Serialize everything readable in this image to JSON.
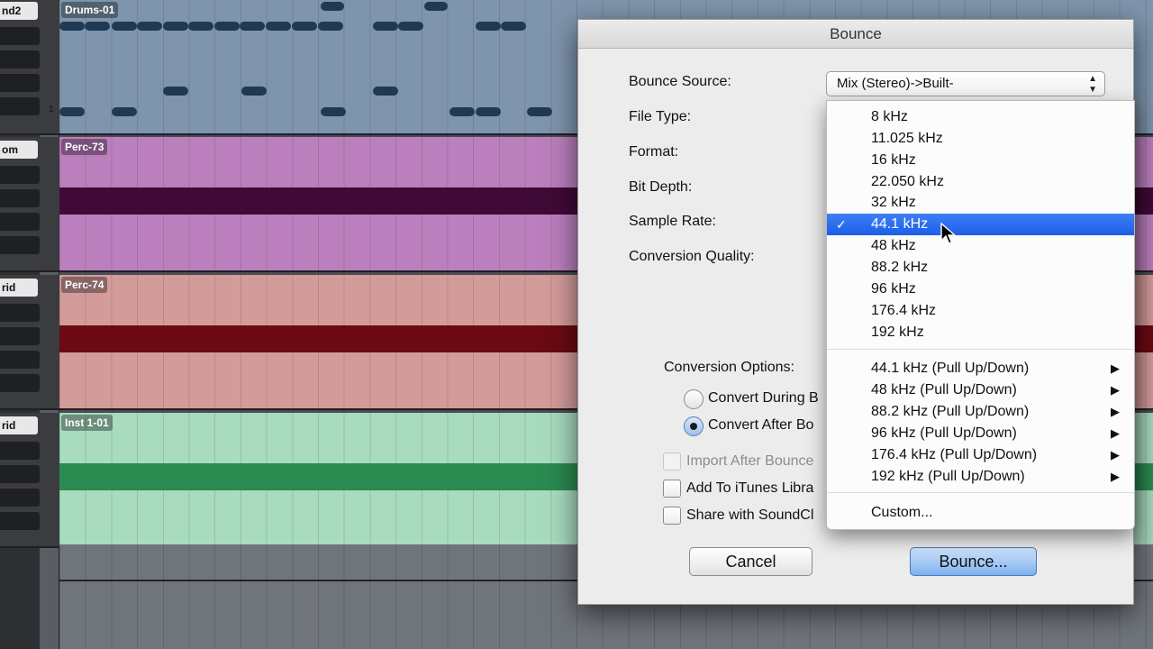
{
  "tracks": [
    {
      "header": "nd2",
      "region": "Drums-01",
      "color": "#7f95ad",
      "bar_color": ""
    },
    {
      "header": "om",
      "region": "Perc-73",
      "color": "#bb7fbe",
      "bar_color": "#3f0a36"
    },
    {
      "header": "rid",
      "region": "Perc-74",
      "color": "#d39c9b",
      "bar_color": "#6b0a12"
    },
    {
      "header": "rid",
      "region": "Inst 1-01",
      "color": "#a8dbbf",
      "bar_color": "#2a8a4f"
    }
  ],
  "drum_ruler_number": "1",
  "dialog": {
    "title": "Bounce",
    "labels": {
      "bounce_source": "Bounce Source:",
      "file_type": "File Type:",
      "format": "Format:",
      "bit_depth": "Bit Depth:",
      "sample_rate": "Sample Rate:",
      "conversion_quality": "Conversion Quality:",
      "conversion_options": "Conversion Options:"
    },
    "bounce_source_value": "Mix (Stereo)->Built-",
    "radio_convert_during": "Convert During B",
    "radio_convert_after": "Convert After Bo",
    "check_import": "Import After Bounce",
    "check_itunes": "Add To iTunes Libra",
    "check_soundcloud": "Share with SoundCl",
    "cancel_label": "Cancel",
    "bounce_label": "Bounce..."
  },
  "menu": {
    "rates": [
      "8 kHz",
      "11.025 kHz",
      "16 kHz",
      "22.050 kHz",
      "32 kHz",
      "44.1 kHz",
      "48 kHz",
      "88.2 kHz",
      "96 kHz",
      "176.4 kHz",
      "192 kHz"
    ],
    "selected": "44.1 kHz",
    "check_mark": "✓",
    "pullups": [
      "44.1 kHz (Pull Up/Down)",
      "48 kHz (Pull Up/Down)",
      "88.2 kHz (Pull Up/Down)",
      "96 kHz (Pull Up/Down)",
      "176.4 kHz (Pull Up/Down)",
      "192 kHz (Pull Up/Down)"
    ],
    "custom": "Custom...",
    "submenu_arrow": "▶",
    "popup_arrows_icon": "updown-arrows-icon"
  },
  "colors": {
    "menu_highlight": "#2a6ef0",
    "primary_button": "#7fb2ef"
  }
}
